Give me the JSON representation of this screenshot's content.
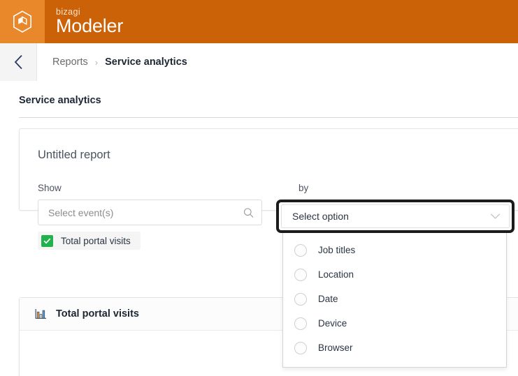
{
  "header": {
    "logo_icon": "bizagi-hexagon-cube-logo",
    "brand_sub": "bizagi",
    "brand_main": "Modeler",
    "bg_color": "#cc6208",
    "logo_bg_color": "#e8882b"
  },
  "breadcrumb": {
    "back_icon": "chevron-left-icon",
    "parent": "Reports",
    "separator": "›",
    "current": "Service analytics"
  },
  "page": {
    "title": "Service analytics"
  },
  "report_card": {
    "title": "Untitled report",
    "show_field": {
      "label": "Show",
      "placeholder": "Select event(s)",
      "value": "",
      "search_icon": "search-icon",
      "chip": {
        "label": "Total portal visits",
        "checked": true,
        "check_color": "#22b24c",
        "check_icon": "check-icon"
      }
    },
    "by_field": {
      "label": "by",
      "value": "Select option",
      "chevron_icon": "chevron-down-icon",
      "focused": true,
      "focus_ring_color": "#1c1c1c"
    }
  },
  "dropdown": {
    "open": true,
    "options": [
      {
        "label": "Job titles",
        "selected": false
      },
      {
        "label": "Location",
        "selected": false
      },
      {
        "label": "Date",
        "selected": false
      },
      {
        "label": "Device",
        "selected": false
      },
      {
        "label": "Browser",
        "selected": false
      }
    ]
  },
  "chart_card": {
    "icon": "bar-chart-icon",
    "title": "Total portal visits"
  }
}
